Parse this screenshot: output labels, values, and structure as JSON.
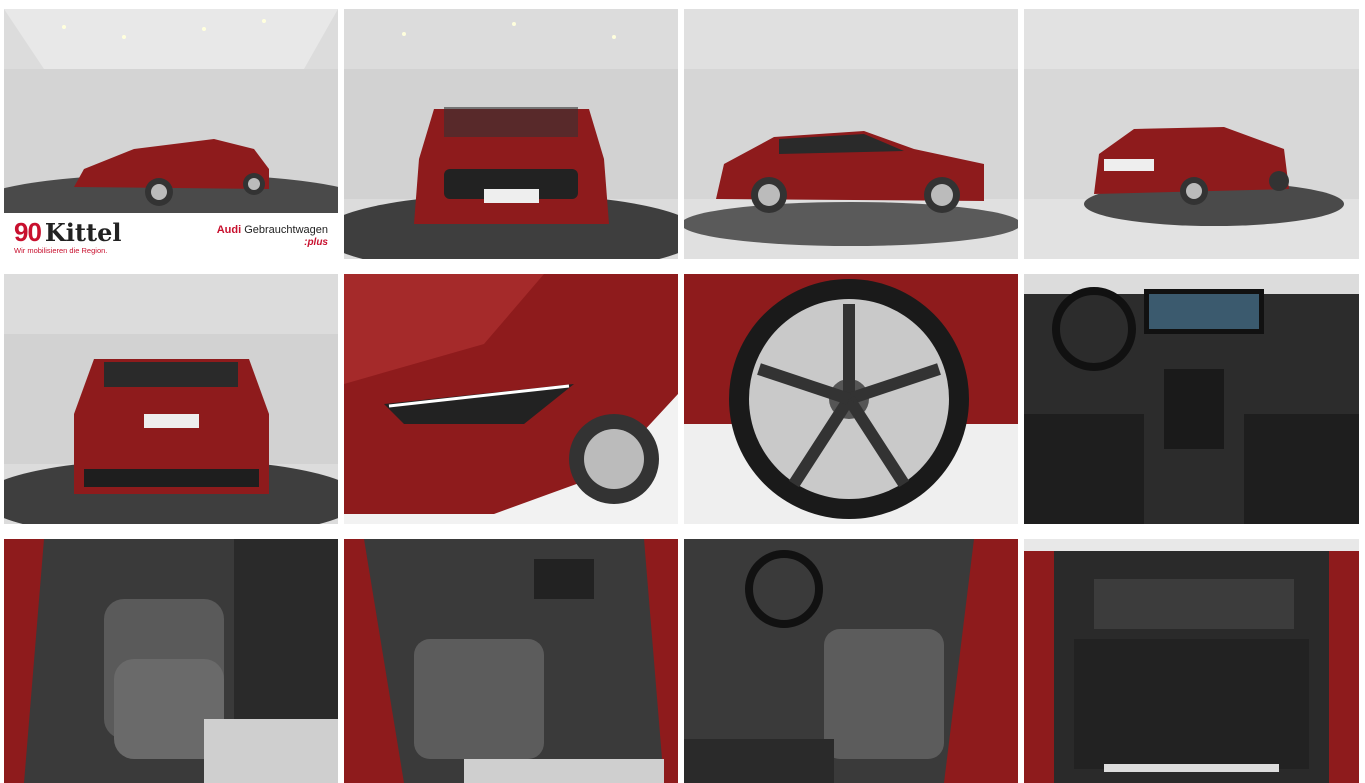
{
  "gallery": {
    "tiles": [
      {
        "id": "t1",
        "subject": "car-front-left-3q"
      },
      {
        "id": "t2",
        "subject": "car-front"
      },
      {
        "id": "t3",
        "subject": "car-side"
      },
      {
        "id": "t4",
        "subject": "car-rear-left-3q"
      },
      {
        "id": "t5",
        "subject": "car-rear"
      },
      {
        "id": "t6",
        "subject": "headlight-detail"
      },
      {
        "id": "t7",
        "subject": "wheel-detail"
      },
      {
        "id": "t8",
        "subject": "dashboard"
      },
      {
        "id": "t9",
        "subject": "rear-seats"
      },
      {
        "id": "t10",
        "subject": "front-seat-passenger"
      },
      {
        "id": "t11",
        "subject": "front-seat-driver"
      },
      {
        "id": "t12",
        "subject": "trunk"
      }
    ]
  },
  "branding": {
    "dealer_number": "90",
    "dealer_name": "Kittel",
    "dealer_tagline": "Wir mobilisieren die Region.",
    "audi_prefix": "Audi",
    "audi_label": "Gebrauchtwagen",
    "audi_plus": ":plus"
  },
  "colors": {
    "car_red": "#8e1b1c",
    "brand_red": "#c8102e"
  }
}
